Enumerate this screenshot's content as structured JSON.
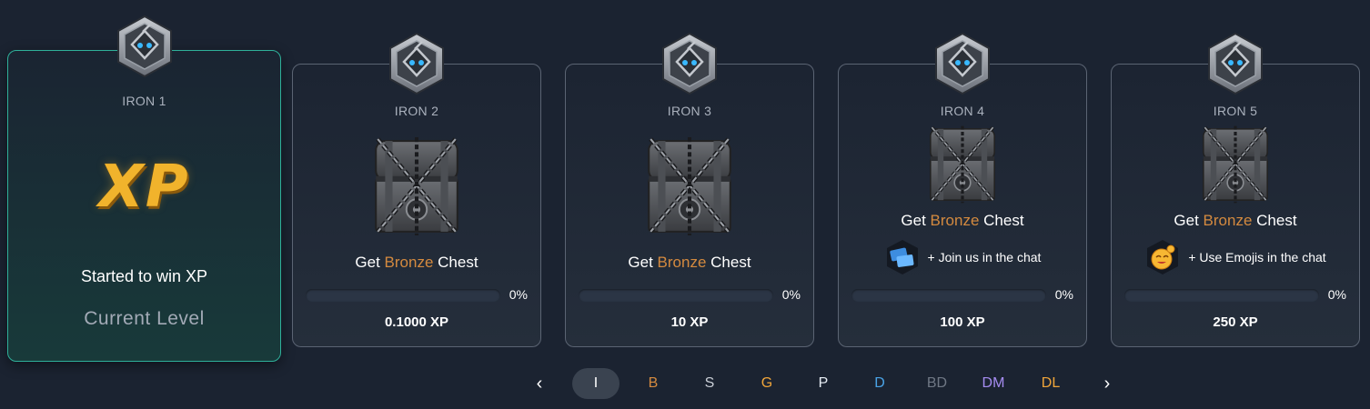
{
  "cards": [
    {
      "level": "IRON 1",
      "current": true,
      "logo_text": "XP",
      "description": "Started to win XP",
      "status": "Current Level"
    },
    {
      "level": "IRON 2",
      "reward_prefix": "Get ",
      "reward_highlight": "Bronze",
      "reward_suffix": " Chest",
      "progress_text": "0%",
      "progress_value": 0,
      "xp": "0.1000 XP"
    },
    {
      "level": "IRON 3",
      "reward_prefix": "Get ",
      "reward_highlight": "Bronze",
      "reward_suffix": " Chest",
      "progress_text": "0%",
      "progress_value": 0,
      "xp": "10 XP"
    },
    {
      "level": "IRON 4",
      "reward_prefix": "Get ",
      "reward_highlight": "Bronze",
      "reward_suffix": " Chest",
      "task": "+ Join us in the chat",
      "task_icon": "chat-tickets-icon",
      "progress_text": "0%",
      "progress_value": 0,
      "xp": "100 XP"
    },
    {
      "level": "IRON 5",
      "reward_prefix": "Get ",
      "reward_highlight": "Bronze",
      "reward_suffix": " Chest",
      "task": "+ Use Emojis in the chat",
      "task_icon": "emoji-icon",
      "progress_text": "0%",
      "progress_value": 0,
      "xp": "250 XP"
    }
  ],
  "pager": {
    "prev": "‹",
    "next": "›",
    "tiers": [
      {
        "label": "I",
        "color": "#ffffff",
        "active": true
      },
      {
        "label": "B",
        "color": "#d48a3f"
      },
      {
        "label": "S",
        "color": "#c9ced6"
      },
      {
        "label": "G",
        "color": "#f0a53a"
      },
      {
        "label": "P",
        "color": "#e8eef5"
      },
      {
        "label": "D",
        "color": "#4aa3e6"
      },
      {
        "label": "BD",
        "color": "#6f7784"
      },
      {
        "label": "DM",
        "color": "#a58cf0"
      },
      {
        "label": "DL",
        "color": "#f0a53a"
      }
    ]
  },
  "colors": {
    "background": "#1b2331",
    "bronze": "#d48a3f",
    "current_border": "#2fb09a",
    "xp_gold": "#f1b32c"
  }
}
